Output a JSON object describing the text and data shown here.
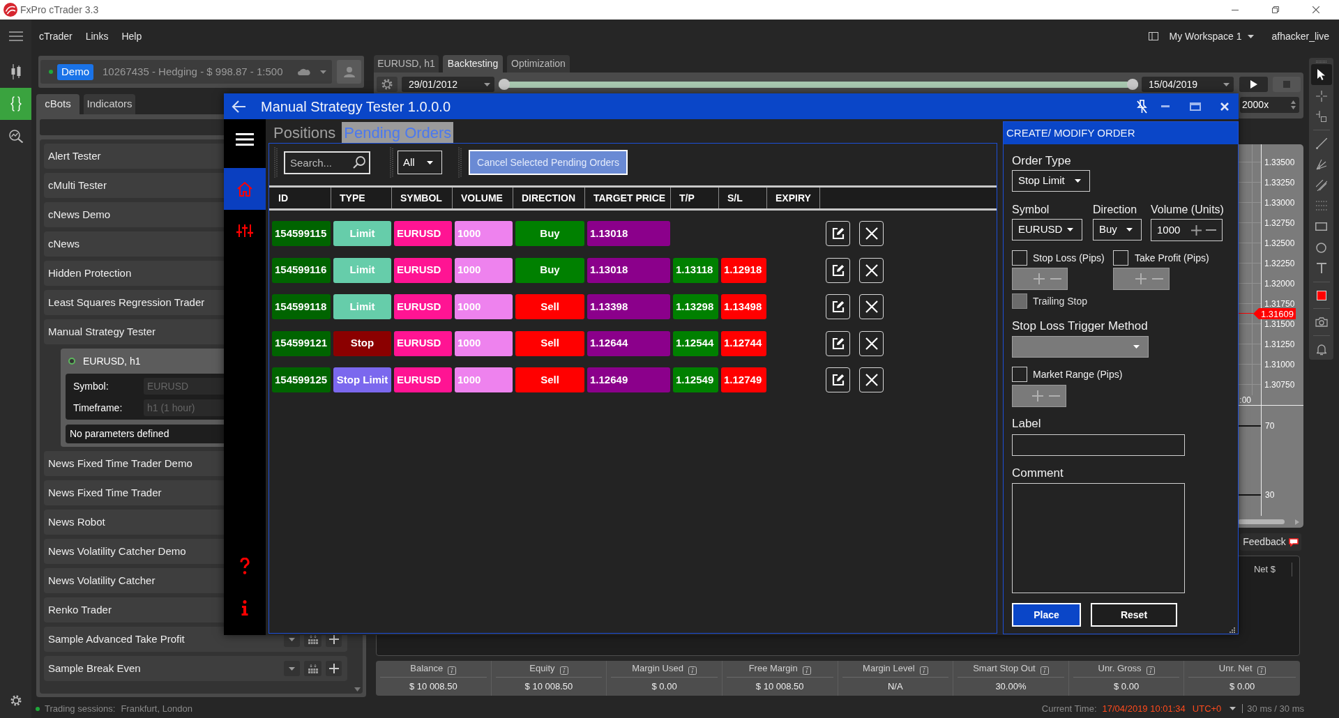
{
  "window": {
    "title": "FxPro cTrader 3.3"
  },
  "menu": [
    "cTrader",
    "Links",
    "Help"
  ],
  "workspace": {
    "label": "My Workspace 1",
    "user": "afhacker_live"
  },
  "rail": [
    {
      "kind": "chart",
      "selected": false
    },
    {
      "kind": "automate",
      "selected": true
    },
    {
      "kind": "analyze",
      "selected": false
    }
  ],
  "account": {
    "online": true,
    "badge": "Demo",
    "details": "10267435 - Hedging - $ 998.87 - 1:500"
  },
  "library_tabs": [
    {
      "label": "cBots",
      "selected": true
    },
    {
      "label": "Indicators",
      "selected": false
    }
  ],
  "cbots": [
    {
      "label": "Alert Tester"
    },
    {
      "label": "cMulti Tester"
    },
    {
      "label": "cNews Demo"
    },
    {
      "label": "cNews"
    },
    {
      "label": "Hidden Protection"
    },
    {
      "label": "Least Squares Regression Trader"
    },
    {
      "label": "Manual Strategy Tester",
      "instances": [
        {
          "name": "EURUSD, h1",
          "settings": [
            {
              "label": "Symbol:",
              "value": "EURUSD",
              "disabled": true
            },
            {
              "label": "Timeframe:",
              "value": "h1 (1 hour)",
              "disabled": true
            }
          ],
          "note": "No parameters defined"
        }
      ]
    },
    {
      "label": "News Fixed Time Trader Demo"
    },
    {
      "label": "News Fixed Time Trader"
    },
    {
      "label": "News Robot"
    },
    {
      "label": "News Volatility Catcher Demo"
    },
    {
      "label": "News Volatility Catcher"
    },
    {
      "label": "Renko Trader"
    },
    {
      "label": "Sample Advanced Take Profit",
      "actions": true
    },
    {
      "label": "Sample Break Even",
      "actions": true
    }
  ],
  "chart_tabs": [
    {
      "label": "EURUSD, h1",
      "selected": false
    },
    {
      "label": "Backtesting",
      "selected": true
    },
    {
      "label": "Optimization",
      "selected": false
    }
  ],
  "backtest": {
    "start": "29/01/2012",
    "end": "15/04/2019",
    "level": 1,
    "speed": "2000x"
  },
  "chart": {
    "price_axis": [
      "1.33500",
      "1.33250",
      "1.33000",
      "1.32750",
      "1.32500",
      "1.32250",
      "1.32000",
      "1.31750",
      "1.31500",
      "1.31250",
      "1.31000",
      "1.30750"
    ],
    "price_tag": "1.31609",
    "time_label": ":00",
    "indicator_axis": [
      "70",
      "30"
    ]
  },
  "feedback": "Feedback",
  "positions": {
    "columns": [
      "Net $"
    ]
  },
  "summary": [
    {
      "label": "Balance",
      "value": "$ 10 008.50"
    },
    {
      "label": "Equity",
      "value": "$ 10 008.50"
    },
    {
      "label": "Margin Used",
      "value": "$ 0.00"
    },
    {
      "label": "Free Margin",
      "value": "$ 10 008.50"
    },
    {
      "label": "Margin Level",
      "value": "N/A"
    },
    {
      "label": "Smart Stop Out",
      "value": "30.00%"
    },
    {
      "label": "Unr. Gross",
      "value": "$ 0.00"
    },
    {
      "label": "Unr. Net",
      "value": "$ 0.00"
    }
  ],
  "drawing_tools": [
    [
      {
        "kind": "cursor",
        "selected": true
      },
      {
        "kind": "crosshair",
        "selected": false
      },
      {
        "kind": "measure",
        "selected": false
      }
    ],
    [
      {
        "kind": "line",
        "selected": false
      },
      {
        "kind": "fan",
        "selected": false
      },
      {
        "kind": "channel",
        "selected": false
      },
      {
        "kind": "levels",
        "selected": false
      },
      {
        "kind": "rectangle",
        "selected": false
      },
      {
        "kind": "ellipse",
        "selected": false
      },
      {
        "kind": "text",
        "selected": false
      }
    ],
    [
      {
        "kind": "color",
        "selected": false
      }
    ],
    [
      {
        "kind": "screenshot",
        "selected": false
      }
    ],
    [
      {
        "kind": "alert",
        "selected": false
      }
    ]
  ],
  "status": {
    "online": true,
    "sessions_label": "Trading sessions:",
    "sessions": "Frankfurt, London",
    "time_label": "Current Time:",
    "time": "17/04/2019 10:01:34",
    "timezone": "UTC+0",
    "latency": "30 ms / 30 ms"
  },
  "tester": {
    "title": "Manual Strategy Tester 1.0.0.0",
    "nav": [
      {
        "kind": "home",
        "selected": true
      },
      {
        "kind": "settings",
        "selected": false
      }
    ],
    "tabs": [
      {
        "label": "Positions",
        "selected": false
      },
      {
        "label": "Pending Orders",
        "selected": true
      }
    ],
    "search": {
      "placeholder": "Search..."
    },
    "filter": {
      "value": "All"
    },
    "cancel": {
      "label": "Cancel Selected Pending Orders",
      "disabled": true
    },
    "columns": [
      "ID",
      "TYPE",
      "SYMBOL",
      "VOLUME",
      "DIRECTION",
      "TARGET PRICE",
      "T/P",
      "S/L",
      "EXPIRY"
    ],
    "orders": [
      {
        "id": "154599115",
        "type": {
          "label": "Limit",
          "color": "#66cdaa"
        },
        "symbol": "EURUSD",
        "volume": "1000",
        "direction": {
          "label": "Buy",
          "color": "#008000"
        },
        "target_price": "1.13018"
      },
      {
        "id": "154599116",
        "type": {
          "label": "Limit",
          "color": "#66cdaa"
        },
        "symbol": "EURUSD",
        "volume": "1000",
        "direction": {
          "label": "Buy",
          "color": "#008000"
        },
        "target_price": "1.13018",
        "take_profit": "1.13118",
        "stop_loss": "1.12918"
      },
      {
        "id": "154599118",
        "type": {
          "label": "Limit",
          "color": "#66cdaa"
        },
        "symbol": "EURUSD",
        "volume": "1000",
        "direction": {
          "label": "Sell",
          "color": "#ff0000"
        },
        "target_price": "1.13398",
        "take_profit": "1.13298",
        "stop_loss": "1.13498"
      },
      {
        "id": "154599121",
        "type": {
          "label": "Stop",
          "color": "#8b0000"
        },
        "symbol": "EURUSD",
        "volume": "1000",
        "direction": {
          "label": "Sell",
          "color": "#ff0000"
        },
        "target_price": "1.12644",
        "take_profit": "1.12544",
        "stop_loss": "1.12744"
      },
      {
        "id": "154599125",
        "type": {
          "label": "Stop Limit",
          "color": "#7b68ee"
        },
        "symbol": "EURUSD",
        "volume": "1000",
        "direction": {
          "label": "Sell",
          "color": "#ff0000"
        },
        "target_price": "1.12649",
        "take_profit": "1.12549",
        "stop_loss": "1.12749"
      }
    ],
    "form": {
      "title": "CREATE/ MODIFY ORDER",
      "order_type": {
        "label": "Order Type",
        "value": "Stop Limit"
      },
      "symbol": {
        "label": "Symbol",
        "value": "EURUSD"
      },
      "direction": {
        "label": "Direction",
        "value": "Buy"
      },
      "volume": {
        "label": "Volume (Units)",
        "value": "1000"
      },
      "stop_loss": {
        "label": "Stop Loss (Pips)",
        "checked": false
      },
      "take_profit": {
        "label": "Take Profit (Pips)",
        "checked": false
      },
      "trailing_stop": {
        "label": "Trailing Stop",
        "checked": false,
        "disabled": true
      },
      "trigger_method": {
        "label": "Stop Loss Trigger Method",
        "disabled": true
      },
      "market_range": {
        "label": "Market Range (Pips)",
        "checked": false
      },
      "label_field": {
        "label": "Label"
      },
      "comment": {
        "label": "Comment"
      },
      "buttons": [
        {
          "label": "Place",
          "kind": "primary"
        },
        {
          "label": "Reset",
          "kind": "secondary"
        }
      ]
    }
  }
}
